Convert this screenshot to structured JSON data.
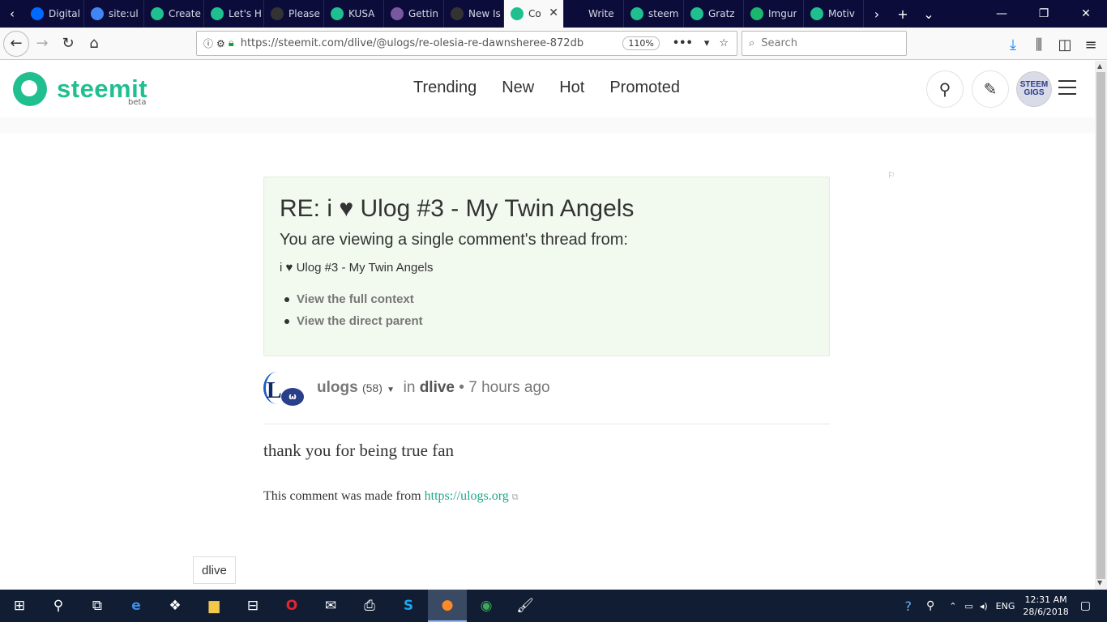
{
  "browser": {
    "tabs": [
      {
        "label": "Digital",
        "icon": "digitalocean-icon",
        "color": "#0069ff"
      },
      {
        "label": "site:ul",
        "icon": "google-icon",
        "color": "#4285f4"
      },
      {
        "label": "Create",
        "icon": "steemit-icon",
        "color": "#1fbf8f"
      },
      {
        "label": "Let's H",
        "icon": "steemit-icon",
        "color": "#1fbf8f"
      },
      {
        "label": "Please",
        "icon": "github-icon",
        "color": "#333333"
      },
      {
        "label": "KUSA",
        "icon": "steemit-icon",
        "color": "#1fbf8f"
      },
      {
        "label": "Gettin",
        "icon": "heroku-icon",
        "color": "#79589f"
      },
      {
        "label": "New Is",
        "icon": "github-icon",
        "color": "#333333"
      },
      {
        "label": "Co",
        "icon": "steemit-icon",
        "color": "#1fbf8f",
        "active": true
      },
      {
        "label": "Write",
        "icon": "blank-icon",
        "color": "#0c0c3a"
      },
      {
        "label": "steem",
        "icon": "steemit-icon",
        "color": "#1fbf8f"
      },
      {
        "label": "Gratz",
        "icon": "steemit-icon",
        "color": "#1fbf8f"
      },
      {
        "label": "Imgur",
        "icon": "imgur-icon",
        "color": "#1bb76e"
      },
      {
        "label": "Motiv",
        "icon": "steemit-icon",
        "color": "#1fbf8f"
      }
    ],
    "url": "https://steemit.com/dlive/@ulogs/re-olesia-re-dawnsheree-872db",
    "zoom": "110%",
    "search_placeholder": "Search"
  },
  "site": {
    "logo_text": "steemit",
    "logo_beta": "beta",
    "nav": [
      "Trending",
      "New",
      "Hot",
      "Promoted"
    ],
    "avatar_line1": "STEEM",
    "avatar_line2": "GIGS",
    "accent": "#1fbf8f"
  },
  "callout": {
    "title": "RE: i ♥ Ulog #3 - My Twin Angels",
    "subtitle": "You are viewing a single comment's thread from:",
    "parent_title": "i ♥ Ulog #3 - My Twin Angels",
    "links": [
      "View the full context",
      "View the direct parent"
    ]
  },
  "comment": {
    "author": "ulogs",
    "reputation": "(58)",
    "in_label": "in",
    "category": "dlive",
    "separator": "•",
    "time": "7 hours ago",
    "body": "thank you for being true fan",
    "footer_text": "This comment was made from ",
    "footer_link": "https://ulogs.org"
  },
  "tooltip": "dlive",
  "taskbar": {
    "lang": "ENG",
    "time": "12:31 AM",
    "date": "28/6/2018"
  }
}
